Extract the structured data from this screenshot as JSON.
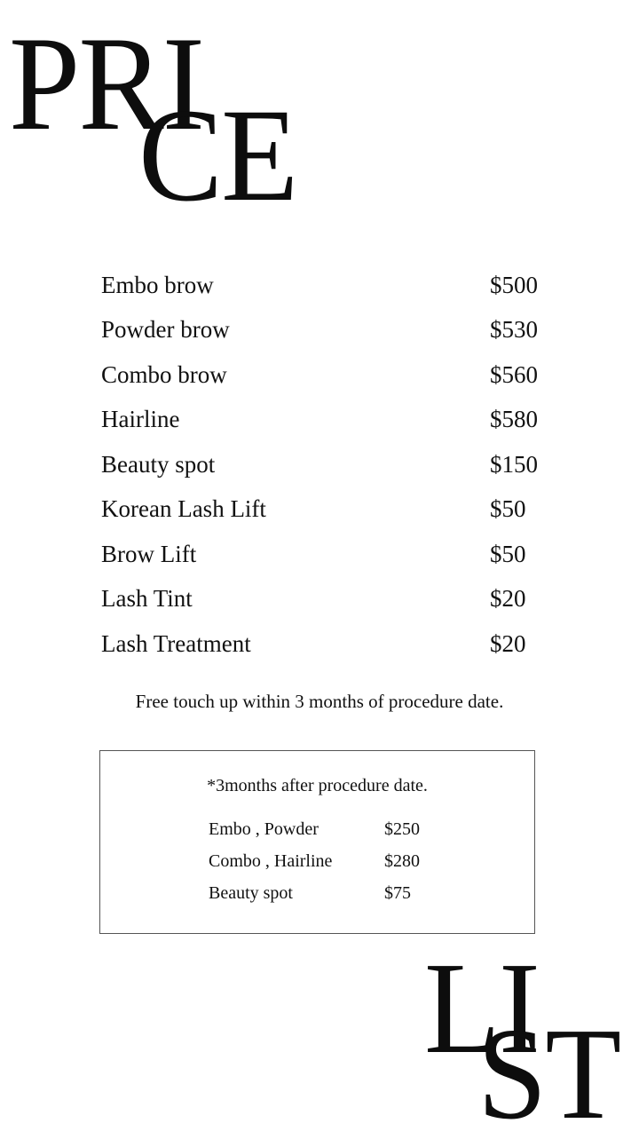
{
  "title": {
    "part1": "PRI",
    "part2": "CE",
    "part3": "LI",
    "part4": "ST"
  },
  "prices": [
    {
      "name": "Embo brow",
      "price": "$500"
    },
    {
      "name": "Powder brow",
      "price": "$530"
    },
    {
      "name": "Combo brow",
      "price": "$560"
    },
    {
      "name": "Hairline",
      "price": "$580"
    },
    {
      "name": "Beauty spot",
      "price": "$150"
    },
    {
      "name": "Korean Lash Lift",
      "price": "$50"
    },
    {
      "name": "Brow Lift",
      "price": "$50"
    },
    {
      "name": "Lash Tint",
      "price": "$20"
    },
    {
      "name": "Lash Treatment",
      "price": "$20"
    }
  ],
  "note": "Free touch up within 3 months of procedure date.",
  "touchup": {
    "heading": "*3months after procedure date.",
    "items": [
      {
        "name": "Embo , Powder",
        "price": "$250"
      },
      {
        "name": "Combo , Hairline",
        "price": "$280"
      },
      {
        "name": "Beauty spot",
        "price": "$75"
      }
    ]
  }
}
